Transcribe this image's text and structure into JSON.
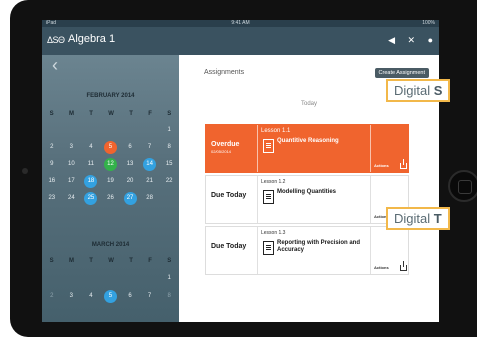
{
  "status_bar": {
    "carrier": "iPad",
    "time": "9:41 AM",
    "battery": "100%"
  },
  "top_bar": {
    "logo": "ΔSΘ",
    "course": "Algebra 1",
    "icons": [
      "megaphone-icon",
      "tools-icon",
      "user-icon"
    ]
  },
  "sidebar": {
    "back_label": "‹",
    "calendars": [
      {
        "month": "FEBRUARY 2014",
        "days": [
          "S",
          "M",
          "T",
          "W",
          "T",
          "F",
          "S"
        ],
        "weeks": [
          [
            "",
            "",
            "",
            "",
            "",
            "",
            "1"
          ],
          [
            "2",
            "3",
            "4",
            "5",
            "6",
            "7",
            "8"
          ],
          [
            "9",
            "10",
            "11",
            "12",
            "13",
            "14",
            "15"
          ],
          [
            "16",
            "17",
            "18",
            "19",
            "20",
            "21",
            "22"
          ],
          [
            "23",
            "24",
            "25",
            "26",
            "27",
            "28",
            ""
          ]
        ]
      },
      {
        "month": "MARCH 2014",
        "days": [
          "S",
          "M",
          "T",
          "W",
          "T",
          "F",
          "S"
        ],
        "weeks": [
          [
            "",
            "",
            "",
            "",
            "",
            "",
            "1"
          ],
          [
            "2",
            "3",
            "4",
            "5",
            "6",
            "7",
            "8"
          ]
        ]
      }
    ]
  },
  "main": {
    "title": "Assignments",
    "create_button": "Create Assignment",
    "today_label": "Today",
    "rows": [
      {
        "status": "Overdue",
        "date": "02/05/2014",
        "lesson": "Lesson 1.1",
        "name": "Quantitive Reasoning",
        "actions": "Actions"
      },
      {
        "status": "Due Today",
        "date": "",
        "lesson": "Lesson 1.2",
        "name": "Modelling Quantities",
        "actions": "Actions"
      },
      {
        "status": "Due Today",
        "date": "",
        "lesson": "Lesson 1.3",
        "name": "Reporting with Precision and Accuracy",
        "actions": "Actions"
      }
    ]
  },
  "callouts": [
    {
      "prefix": "Digital ",
      "bold": "S"
    },
    {
      "prefix": "Digital ",
      "bold": "T"
    }
  ],
  "colors": {
    "accent": "#f0642e",
    "header": "#3a5260",
    "highlight_green": "#33b24a",
    "highlight_blue": "#33a1e0"
  }
}
